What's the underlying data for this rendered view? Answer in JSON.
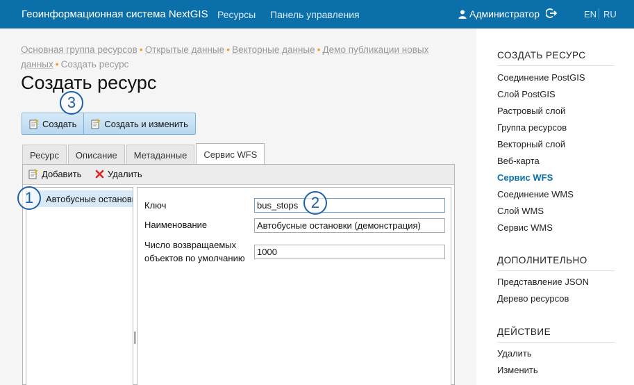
{
  "header": {
    "brand": "Геоинформационная система NextGIS",
    "nav": [
      "Ресурсы",
      "Панель управления"
    ],
    "user": "Администратор",
    "lang": [
      "EN",
      "RU"
    ]
  },
  "breadcrumb": {
    "items": [
      "Основная группа ресурсов",
      "Открытые данные",
      "Векторные данные",
      "Демо публикации новых данных"
    ],
    "current": "Создать ресурс"
  },
  "page_title": "Создать ресурс",
  "actions": {
    "create": "Создать",
    "create_edit": "Создать и изменить"
  },
  "tabs": [
    "Ресурс",
    "Описание",
    "Метаданные",
    "Сервис WFS"
  ],
  "toolbar": {
    "add": "Добавить",
    "delete": "Удалить"
  },
  "tree": {
    "item": "Автобусные остановки (демонстрация)"
  },
  "form": {
    "key_label": "Ключ",
    "key_value": "bus_stops",
    "name_label": "Наименование",
    "name_value": "Автобусные остановки (демонстрация)",
    "count_label_1": "Число возвращаемых",
    "count_label_2": "объектов по умолчанию",
    "count_value": "1000"
  },
  "annotations": [
    "1",
    "2",
    "3"
  ],
  "sidebar": {
    "create_head": "СОЗДАТЬ РЕСУРС",
    "create_items": [
      "Соединение PostGIS",
      "Слой PostGIS",
      "Растровый слой",
      "Группа ресурсов",
      "Векторный слой",
      "Веб-карта",
      "Сервис WFS",
      "Соединение WMS",
      "Слой WMS",
      "Сервис WMS"
    ],
    "extra_head": "ДОПОЛНИТЕЛЬНО",
    "extra_items": [
      "Представление JSON",
      "Дерево ресурсов"
    ],
    "action_head": "ДЕЙСТВИЕ",
    "action_items": [
      "Удалить",
      "Изменить"
    ]
  },
  "colors": {
    "header": "#0b70aa",
    "accent": "#0b70aa",
    "annotation": "#1e5fa8",
    "breadcrumb_dot": "#f0a030"
  }
}
